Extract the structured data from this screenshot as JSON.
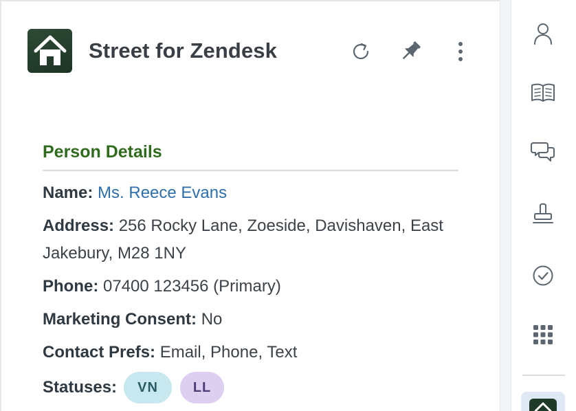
{
  "header": {
    "app_title": "Street for Zendesk",
    "logo_icon": "house-icon",
    "actions": [
      {
        "name": "refresh",
        "icon": "refresh-icon"
      },
      {
        "name": "pin",
        "icon": "pin-icon"
      },
      {
        "name": "more",
        "icon": "kebab-menu-icon"
      }
    ]
  },
  "person": {
    "section_title": "Person Details",
    "name_label": "Name:",
    "name_value": "Ms. Reece Evans",
    "address_label": "Address:",
    "address_value": "256 Rocky Lane, Zoeside, Davishaven, East Jakebury, M28 1NY",
    "phone_label": "Phone:",
    "phone_value": "07400 123456 (Primary)",
    "consent_label": "Marketing Consent:",
    "consent_value": "No",
    "prefs_label": "Contact Prefs:",
    "prefs_value": "Email, Phone, Text",
    "statuses_label": "Statuses:",
    "statuses": [
      {
        "code": "VN",
        "color": "#c7e8ef"
      },
      {
        "code": "LL",
        "color": "#dccff0"
      }
    ]
  },
  "rail": {
    "items": [
      {
        "icon": "user-icon"
      },
      {
        "icon": "knowledge-book-icon"
      },
      {
        "icon": "chat-bubbles-icon"
      },
      {
        "icon": "stamp-icon"
      },
      {
        "icon": "check-circle-icon"
      },
      {
        "icon": "apps-grid-icon"
      }
    ],
    "active_app_icon": "house-icon"
  },
  "colors": {
    "section_title": "#2f6b1c",
    "link": "#2e6fae",
    "logo_bg": "#1d3424"
  }
}
